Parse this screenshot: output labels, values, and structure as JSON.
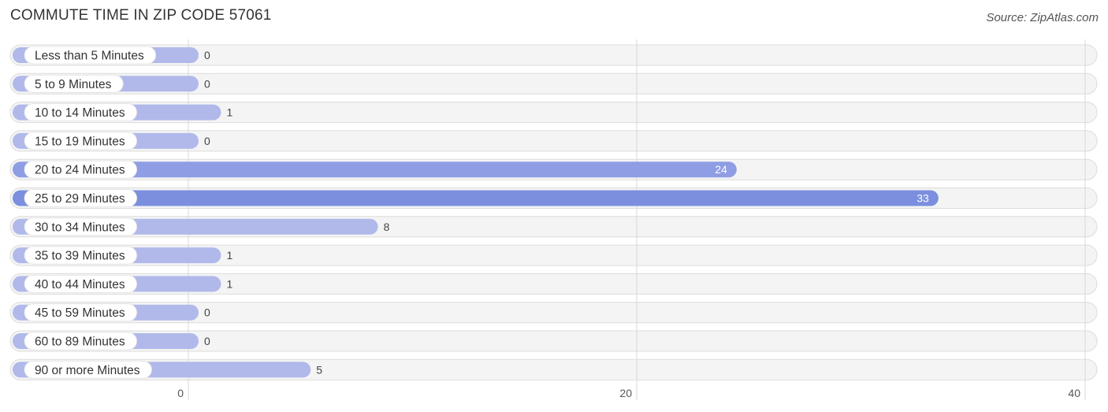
{
  "header": {
    "title": "COMMUTE TIME IN ZIP CODE 57061",
    "source": "Source: ZipAtlas.com"
  },
  "colors": {
    "bar_light": "#b0b9ea",
    "bar_mid": "#8f9de4",
    "bar_strong": "#7b8fde",
    "track": "#f4f4f4",
    "track_border": "#dcdcdc",
    "grid": "#d9d9d9"
  },
  "chart_data": {
    "type": "bar",
    "orientation": "horizontal",
    "title": "COMMUTE TIME IN ZIP CODE 57061",
    "xlabel": "",
    "ylabel": "",
    "xlim": [
      0,
      40
    ],
    "x_ticks": [
      0,
      20,
      40
    ],
    "grid": true,
    "categories": [
      "Less than 5 Minutes",
      "5 to 9 Minutes",
      "10 to 14 Minutes",
      "15 to 19 Minutes",
      "20 to 24 Minutes",
      "25 to 29 Minutes",
      "30 to 34 Minutes",
      "35 to 39 Minutes",
      "40 to 44 Minutes",
      "45 to 59 Minutes",
      "60 to 89 Minutes",
      "90 or more Minutes"
    ],
    "values": [
      0,
      0,
      1,
      0,
      24,
      33,
      8,
      1,
      1,
      0,
      0,
      5
    ]
  }
}
